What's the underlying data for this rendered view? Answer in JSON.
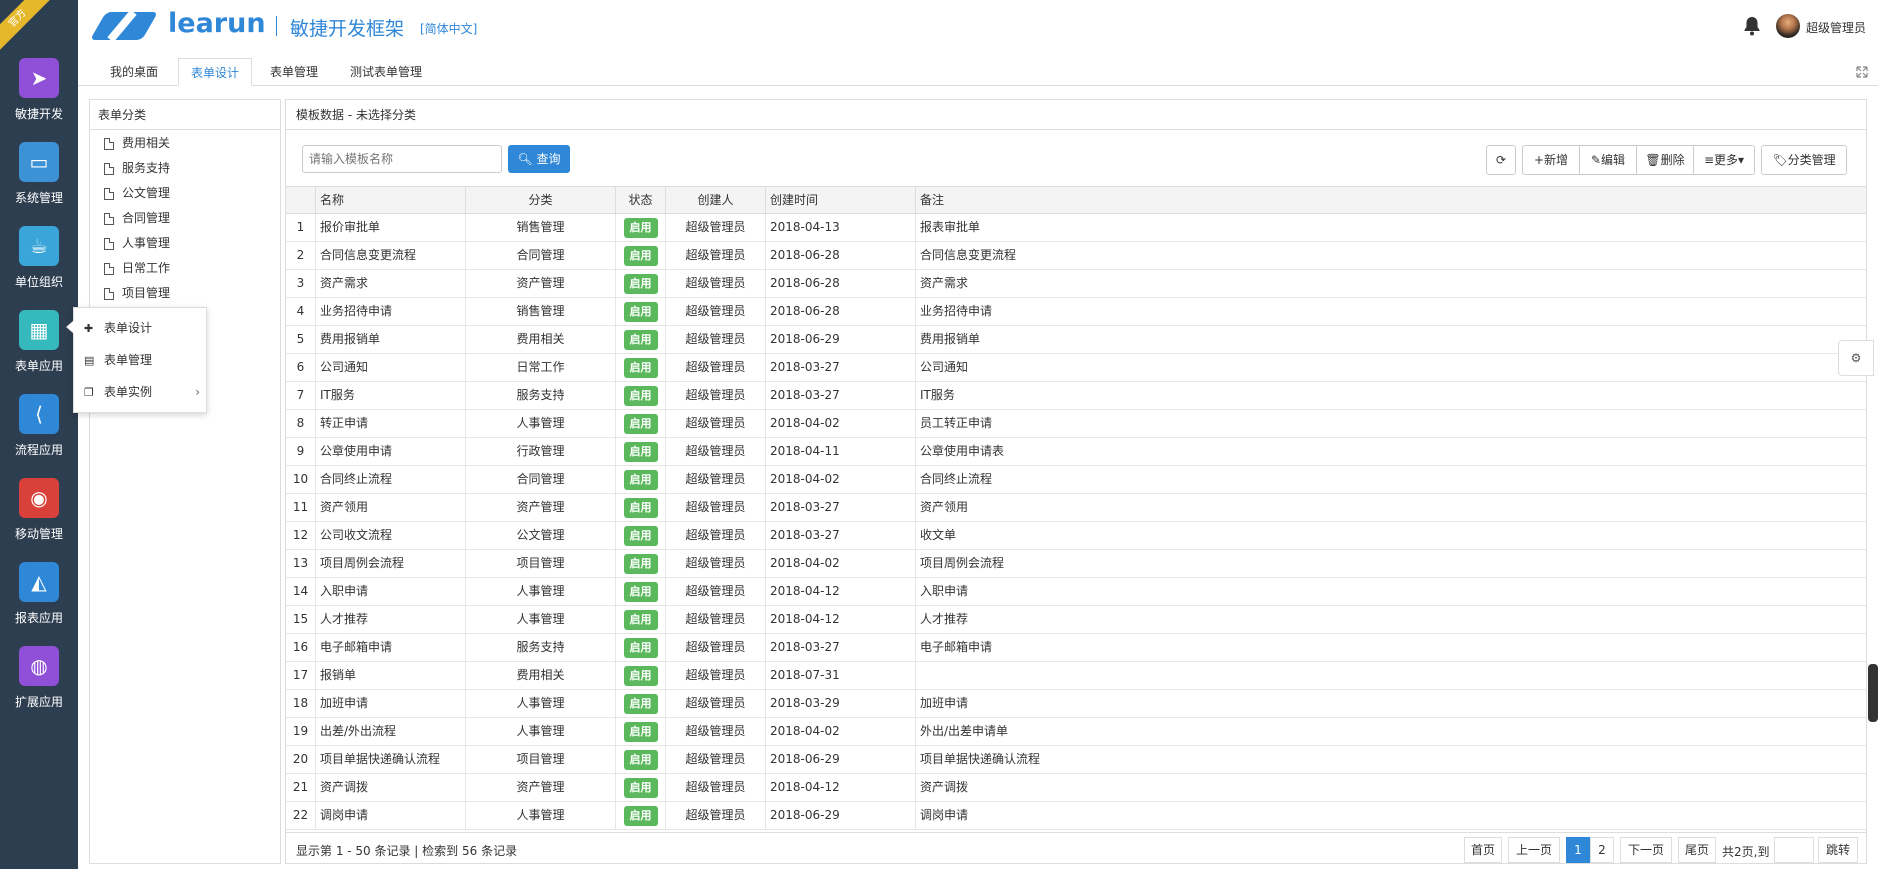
{
  "ribbon": "官方",
  "sidebar": {
    "items": [
      {
        "label": "敏捷开发",
        "icon": "paper-plane-icon",
        "color": "#8f4fd6"
      },
      {
        "label": "系统管理",
        "icon": "monitor-icon",
        "color": "#3d92d6"
      },
      {
        "label": "单位组织",
        "icon": "coffee-icon",
        "color": "#3aa5d8"
      },
      {
        "label": "表单应用",
        "icon": "table-icon",
        "color": "#36b9bd"
      },
      {
        "label": "流程应用",
        "icon": "share-icon",
        "color": "#2f87d8"
      },
      {
        "label": "移动管理",
        "icon": "android-icon",
        "color": "#d9403a"
      },
      {
        "label": "报表应用",
        "icon": "area-chart-icon",
        "color": "#2f87d8"
      },
      {
        "label": "扩展应用",
        "icon": "globe-icon",
        "color": "#8f4fd6"
      }
    ]
  },
  "header": {
    "brand": "learun",
    "subtitle": "敏捷开发框架",
    "language": "[简体中文]",
    "user": "超级管理员"
  },
  "tabs": [
    "我的桌面",
    "表单设计",
    "表单管理",
    "测试表单管理"
  ],
  "tree": {
    "title": "表单分类",
    "items": [
      "费用相关",
      "服务支持",
      "公文管理",
      "合同管理",
      "人事管理",
      "日常工作",
      "项目管理"
    ]
  },
  "popup": {
    "items": [
      "表单设计",
      "表单管理",
      "表单实例"
    ]
  },
  "main": {
    "title": "模板数据 - 未选择分类",
    "search_placeholder": "请输入模板名称",
    "query_label": "查询",
    "toolbar": {
      "refresh": "⟳",
      "add": "新增",
      "edit": "编辑",
      "delete": "删除",
      "more": "更多",
      "category": "分类管理"
    }
  },
  "grid": {
    "columns": [
      "名称",
      "分类",
      "状态",
      "创建人",
      "创建时间",
      "备注"
    ],
    "rows": [
      {
        "n": "1",
        "name": "报价审批单",
        "cat": "销售管理",
        "status": "启用",
        "creator": "超级管理员",
        "date": "2018-04-13",
        "note": "报表审批单"
      },
      {
        "n": "2",
        "name": "合同信息变更流程",
        "cat": "合同管理",
        "status": "启用",
        "creator": "超级管理员",
        "date": "2018-06-28",
        "note": "合同信息变更流程"
      },
      {
        "n": "3",
        "name": "资产需求",
        "cat": "资产管理",
        "status": "启用",
        "creator": "超级管理员",
        "date": "2018-06-28",
        "note": "资产需求"
      },
      {
        "n": "4",
        "name": "业务招待申请",
        "cat": "销售管理",
        "status": "启用",
        "creator": "超级管理员",
        "date": "2018-06-28",
        "note": "业务招待申请"
      },
      {
        "n": "5",
        "name": "费用报销单",
        "cat": "费用相关",
        "status": "启用",
        "creator": "超级管理员",
        "date": "2018-06-29",
        "note": "费用报销单"
      },
      {
        "n": "6",
        "name": "公司通知",
        "cat": "日常工作",
        "status": "启用",
        "creator": "超级管理员",
        "date": "2018-03-27",
        "note": "公司通知"
      },
      {
        "n": "7",
        "name": "IT服务",
        "cat": "服务支持",
        "status": "启用",
        "creator": "超级管理员",
        "date": "2018-03-27",
        "note": "IT服务"
      },
      {
        "n": "8",
        "name": "转正申请",
        "cat": "人事管理",
        "status": "启用",
        "creator": "超级管理员",
        "date": "2018-04-02",
        "note": "员工转正申请"
      },
      {
        "n": "9",
        "name": "公章使用申请",
        "cat": "行政管理",
        "status": "启用",
        "creator": "超级管理员",
        "date": "2018-04-11",
        "note": "公章使用申请表"
      },
      {
        "n": "10",
        "name": "合同终止流程",
        "cat": "合同管理",
        "status": "启用",
        "creator": "超级管理员",
        "date": "2018-04-02",
        "note": "合同终止流程"
      },
      {
        "n": "11",
        "name": "资产领用",
        "cat": "资产管理",
        "status": "启用",
        "creator": "超级管理员",
        "date": "2018-03-27",
        "note": "资产领用"
      },
      {
        "n": "12",
        "name": "公司收文流程",
        "cat": "公文管理",
        "status": "启用",
        "creator": "超级管理员",
        "date": "2018-03-27",
        "note": "收文单"
      },
      {
        "n": "13",
        "name": "项目周例会流程",
        "cat": "项目管理",
        "status": "启用",
        "creator": "超级管理员",
        "date": "2018-04-02",
        "note": "项目周例会流程"
      },
      {
        "n": "14",
        "name": "入职申请",
        "cat": "人事管理",
        "status": "启用",
        "creator": "超级管理员",
        "date": "2018-04-12",
        "note": "入职申请"
      },
      {
        "n": "15",
        "name": "人才推荐",
        "cat": "人事管理",
        "status": "启用",
        "creator": "超级管理员",
        "date": "2018-04-12",
        "note": "人才推荐"
      },
      {
        "n": "16",
        "name": "电子邮箱申请",
        "cat": "服务支持",
        "status": "启用",
        "creator": "超级管理员",
        "date": "2018-03-27",
        "note": "电子邮箱申请"
      },
      {
        "n": "17",
        "name": "报销单",
        "cat": "费用相关",
        "status": "启用",
        "creator": "超级管理员",
        "date": "2018-07-31",
        "note": ""
      },
      {
        "n": "18",
        "name": "加班申请",
        "cat": "人事管理",
        "status": "启用",
        "creator": "超级管理员",
        "date": "2018-03-29",
        "note": "加班申请"
      },
      {
        "n": "19",
        "name": "出差/外出流程",
        "cat": "人事管理",
        "status": "启用",
        "creator": "超级管理员",
        "date": "2018-04-02",
        "note": "外出/出差申请单"
      },
      {
        "n": "20",
        "name": "项目单据快递确认流程",
        "cat": "项目管理",
        "status": "启用",
        "creator": "超级管理员",
        "date": "2018-06-29",
        "note": "项目单据快递确认流程"
      },
      {
        "n": "21",
        "name": "资产调拨",
        "cat": "资产管理",
        "status": "启用",
        "creator": "超级管理员",
        "date": "2018-04-12",
        "note": "资产调拨"
      },
      {
        "n": "22",
        "name": "调岗申请",
        "cat": "人事管理",
        "status": "启用",
        "creator": "超级管理员",
        "date": "2018-06-29",
        "note": "调岗申请"
      }
    ]
  },
  "footer": {
    "records": "显示第 1 - 50 条记录 | 检索到 56 条记录",
    "first": "首页",
    "prev": "上一页",
    "page1": "1",
    "page2": "2",
    "next": "下一页",
    "last": "尾页",
    "total": "共2页,到",
    "go": "跳转"
  }
}
